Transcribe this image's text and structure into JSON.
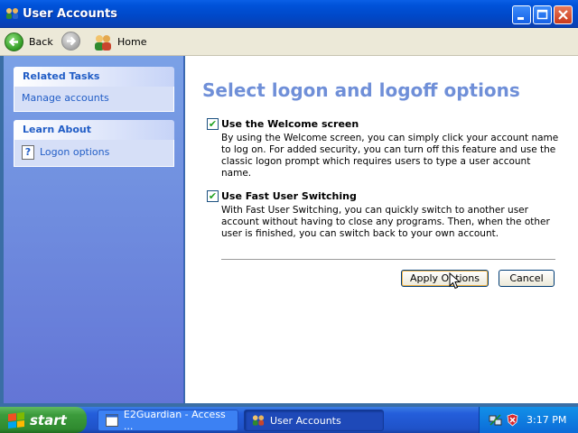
{
  "window": {
    "title": "User Accounts",
    "controls": {
      "minimize": "minimize-icon",
      "maximize": "maximize-icon",
      "close": "close-icon"
    }
  },
  "nav": {
    "back_label": "Back",
    "home_label": "Home",
    "icons": {
      "back": "back-arrow-icon",
      "forward": "forward-arrow-icon",
      "home": "users-home-icon"
    }
  },
  "sidebar": {
    "related_tasks": {
      "title": "Related Tasks",
      "items": [
        {
          "label": "Manage accounts"
        }
      ]
    },
    "learn_about": {
      "title": "Learn About",
      "items": [
        {
          "label": "Logon options",
          "icon": "help-icon"
        }
      ]
    }
  },
  "main": {
    "heading": "Select logon and logoff options",
    "options": [
      {
        "label": "Use the Welcome screen",
        "checked": true,
        "description": "By using the Welcome screen, you can simply click your account name to log on. For added security, you can turn off this feature and use the classic logon prompt which requires users to type a user account name."
      },
      {
        "label": "Use Fast User Switching",
        "checked": true,
        "description": "With Fast User Switching, you can quickly switch to another user account without having to close any programs. Then, when the other user is finished, you can switch back to your own account."
      }
    ],
    "apply_label": "Apply Options",
    "cancel_label": "Cancel"
  },
  "taskbar": {
    "start_label": "start",
    "tasks": [
      {
        "label": "E2Guardian - Access ..."
      },
      {
        "label": "User Accounts"
      }
    ],
    "clock": "3:17 PM"
  },
  "colors": {
    "titlebar": "#0052d9",
    "heading": "#6f8fd8",
    "link": "#215dc6",
    "sidebar": "#7aa1e6"
  }
}
